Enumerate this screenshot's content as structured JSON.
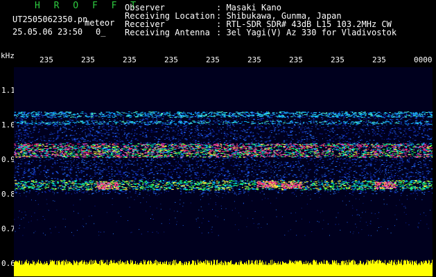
{
  "header": {
    "title": "H R O F F T",
    "filename": "UT2505062350.pn",
    "mode": "meteor",
    "datetime": "25.05.06 23:50",
    "counter": "0_",
    "observer_label": "Observer",
    "observer_value": ": Masaki Kano",
    "location_label": "Receiving Location",
    "location_value": ": Shibukawa, Gunma, Japan",
    "receiver_label": "Receiver",
    "receiver_value": ": RTL-SDR SDR# 43dB L15 103.2MHz CW",
    "antenna_label": "Receiving Antenna",
    "antenna_value": ": 3el Yagi(V) Az 330 for Vladivostok"
  },
  "axis": {
    "unit": "kHz",
    "time_ticks": [
      "235",
      "235",
      "235",
      "235",
      "235",
      "235",
      "235",
      "235",
      "235",
      "0000"
    ],
    "freq_ticks": [
      "1.1",
      "1.0",
      "0.9",
      "0.8",
      "0.7",
      "0.6"
    ]
  },
  "colors": {
    "title": "#2ecc40",
    "background": "#00001e",
    "level_bar": "#ffff00"
  }
}
